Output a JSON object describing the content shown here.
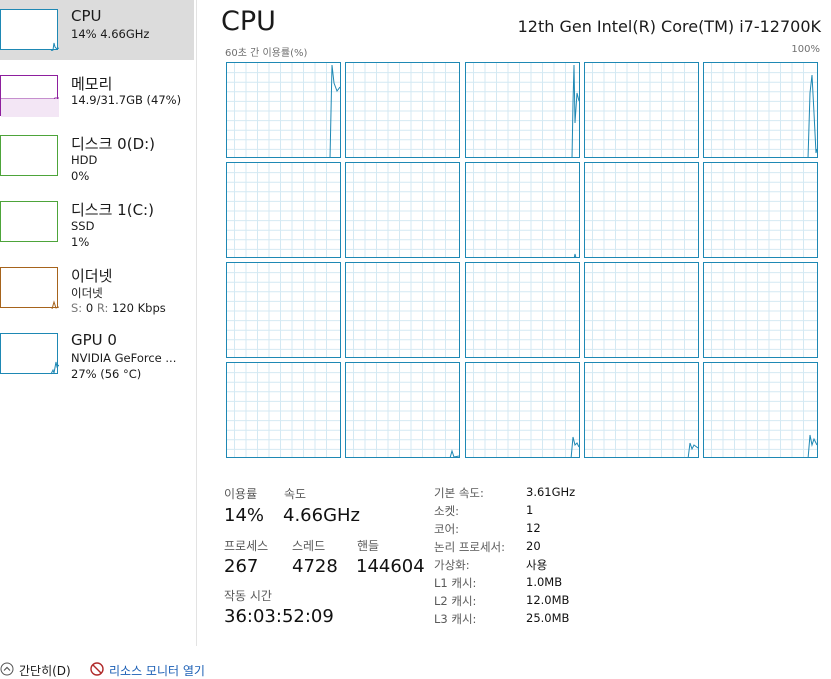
{
  "sidebar": {
    "items": [
      {
        "title": "CPU",
        "line1": "14% 4.66GHz",
        "line2": "",
        "color": "#1e88b4",
        "selected": true
      },
      {
        "title": "메모리",
        "line1": "14.9/31.7GB (47%)",
        "line2": "",
        "color": "#8e1f9e",
        "selected": false
      },
      {
        "title": "디스크 0(D:)",
        "line1": "HDD",
        "line2": "0%",
        "color": "#4da43a",
        "selected": false
      },
      {
        "title": "디스크 1(C:)",
        "line1": "SSD",
        "line2": "1%",
        "color": "#4da43a",
        "selected": false
      },
      {
        "title": "이더넷",
        "line1": "이더넷",
        "line2_send_label": "S:",
        "line2_send": "0",
        "line2_recv_label": "R:",
        "line2_recv": "120 Kbps",
        "color": "#a6631c",
        "selected": false
      },
      {
        "title": "GPU 0",
        "line1": "NVIDIA GeForce ...",
        "line2": "27% (56 °C)",
        "color": "#1e88b4",
        "selected": false
      }
    ]
  },
  "main": {
    "title": "CPU",
    "cpu_model": "12th Gen Intel(R) Core(TM) i7-12700K",
    "axis_label": "60초 간 이용률(%)",
    "axis_max": "100%",
    "accent_color": "#1e88b4"
  },
  "stats": {
    "utilization_label": "이용률",
    "utilization_value": "14%",
    "speed_label": "속도",
    "speed_value": "4.66GHz",
    "processes_label": "프로세스",
    "processes_value": "267",
    "threads_label": "스레드",
    "threads_value": "4728",
    "handles_label": "핸들",
    "handles_value": "144604",
    "uptime_label": "작동 시간",
    "uptime_value": "36:03:52:09"
  },
  "specs": [
    {
      "label": "기본 속도:",
      "value": "3.61GHz"
    },
    {
      "label": "소켓:",
      "value": "1"
    },
    {
      "label": "코어:",
      "value": "12"
    },
    {
      "label": "논리 프로세서:",
      "value": "20"
    },
    {
      "label": "가상화:",
      "value": "사용"
    },
    {
      "label": "L1 캐시:",
      "value": "1.0MB"
    },
    {
      "label": "L2 캐시:",
      "value": "12.0MB"
    },
    {
      "label": "L3 캐시:",
      "value": "25.0MB"
    }
  ],
  "footer": {
    "collapse_label": "간단히(D)",
    "resmon_label": "리소스 모니터 열기"
  },
  "icons": {
    "collapse": "chevron-up-icon",
    "resmon": "resource-monitor-icon"
  }
}
